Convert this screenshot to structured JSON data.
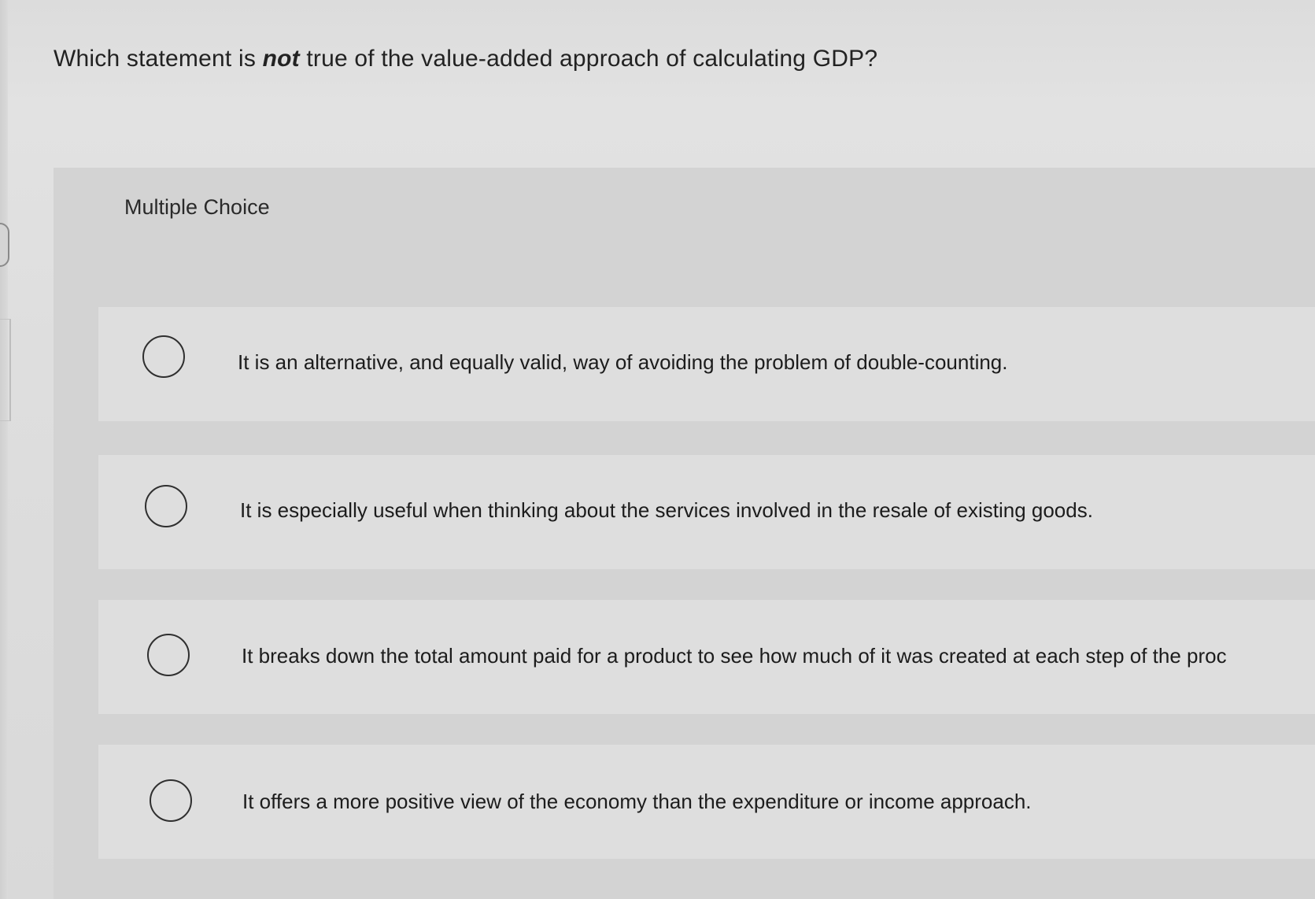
{
  "question": {
    "before": "Which statement is ",
    "emphasis": "not",
    "after": " true of the value-added approach of calculating GDP?"
  },
  "section_label": "Multiple Choice",
  "options": [
    {
      "text": "It is an alternative, and equally valid, way of avoiding the problem of double-counting."
    },
    {
      "text": "It is especially useful when thinking about the services involved in the resale of existing goods."
    },
    {
      "text": "It breaks down the total amount paid for a product to see how much of it was created at each step of the proc"
    },
    {
      "text": "It offers a more positive view of the economy than the expenditure or income approach."
    }
  ],
  "colors": {
    "background": "#dcdcdc",
    "panel": "#d3d3d3",
    "option_row": "#dedede",
    "text": "#1f1f1f",
    "radio_border": "#2f2f2f"
  }
}
